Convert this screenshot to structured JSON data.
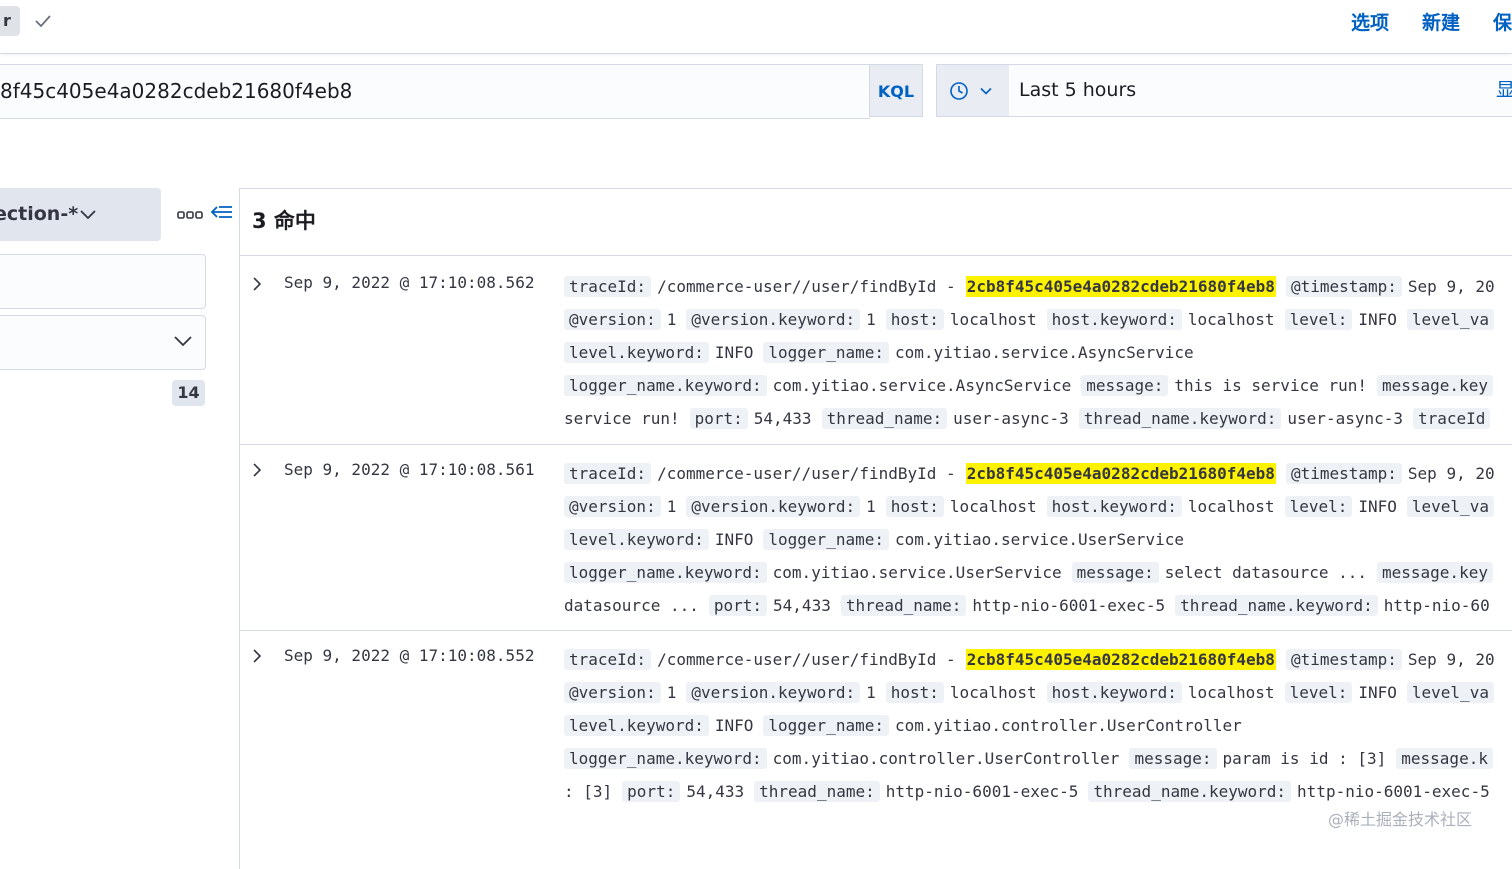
{
  "topbar": {
    "pill_label": "r",
    "options_label": "选项",
    "new_label": "新建",
    "save_label": "保"
  },
  "query": {
    "value": "8f45c405e4a0282cdeb21680f4eb8",
    "kql_label": "KQL"
  },
  "time": {
    "range": "Last 5 hours",
    "show_label": "显"
  },
  "sidebar": {
    "index_pattern": "ection-*",
    "field_count": "14"
  },
  "results": {
    "hits_label": "3 命中",
    "rows": [
      {
        "timestamp": "Sep 9, 2022 @ 17:10:08.562",
        "l1": {
          "k1": "traceId:",
          "v1": "/commerce-user//user/findById -",
          "hl": "2cb8f45c405e4a0282cdeb21680f4eb8",
          "k2": "@timestamp:",
          "v2": "Sep 9, 20"
        },
        "l2": {
          "k1": "@version:",
          "v1": "1",
          "k2": "@version.keyword:",
          "v2": "1",
          "k3": "host:",
          "v3": "localhost",
          "k4": "host.keyword:",
          "v4": "localhost",
          "k5": "level:",
          "v5": "INFO",
          "k6": "level_va"
        },
        "l3": {
          "k1": "level.keyword:",
          "v1": "INFO",
          "k2": "logger_name:",
          "v2": "com.yitiao.service.AsyncService"
        },
        "l4": {
          "k1": "logger_name.keyword:",
          "v1": "com.yitiao.service.AsyncService",
          "k2": "message:",
          "v2": "this is service run!",
          "k3": "message.key"
        },
        "l5": {
          "v0": "service run!",
          "k1": "port:",
          "v1": "54,433",
          "k2": "thread_name:",
          "v2": "user-async-3",
          "k3": "thread_name.keyword:",
          "v3": "user-async-3",
          "k4": "traceId"
        }
      },
      {
        "timestamp": "Sep 9, 2022 @ 17:10:08.561",
        "l1": {
          "k1": "traceId:",
          "v1": "/commerce-user//user/findById -",
          "hl": "2cb8f45c405e4a0282cdeb21680f4eb8",
          "k2": "@timestamp:",
          "v2": "Sep 9, 20"
        },
        "l2": {
          "k1": "@version:",
          "v1": "1",
          "k2": "@version.keyword:",
          "v2": "1",
          "k3": "host:",
          "v3": "localhost",
          "k4": "host.keyword:",
          "v4": "localhost",
          "k5": "level:",
          "v5": "INFO",
          "k6": "level_va"
        },
        "l3": {
          "k1": "level.keyword:",
          "v1": "INFO",
          "k2": "logger_name:",
          "v2": "com.yitiao.service.UserService"
        },
        "l4": {
          "k1": "logger_name.keyword:",
          "v1": "com.yitiao.service.UserService",
          "k2": "message:",
          "v2": "select datasource ...",
          "k3": "message.key"
        },
        "l5": {
          "v0": "datasource ...",
          "k1": "port:",
          "v1": "54,433",
          "k2": "thread_name:",
          "v2": "http-nio-6001-exec-5",
          "k3": "thread_name.keyword:",
          "v3": "http-nio-60",
          "k4": ""
        }
      },
      {
        "timestamp": "Sep 9, 2022 @ 17:10:08.552",
        "l1": {
          "k1": "traceId:",
          "v1": "/commerce-user//user/findById -",
          "hl": "2cb8f45c405e4a0282cdeb21680f4eb8",
          "k2": "@timestamp:",
          "v2": "Sep 9, 20"
        },
        "l2": {
          "k1": "@version:",
          "v1": "1",
          "k2": "@version.keyword:",
          "v2": "1",
          "k3": "host:",
          "v3": "localhost",
          "k4": "host.keyword:",
          "v4": "localhost",
          "k5": "level:",
          "v5": "INFO",
          "k6": "level_va"
        },
        "l3": {
          "k1": "level.keyword:",
          "v1": "INFO",
          "k2": "logger_name:",
          "v2": "com.yitiao.controller.UserController"
        },
        "l4": {
          "k1": "logger_name.keyword:",
          "v1": "com.yitiao.controller.UserController",
          "k2": "message:",
          "v2": "param is id : [3]",
          "k3": "message.k"
        },
        "l5": {
          "v0": ": [3]",
          "k1": "port:",
          "v1": "54,433",
          "k2": "thread_name:",
          "v2": "http-nio-6001-exec-5",
          "k3": "thread_name.keyword:",
          "v3": "http-nio-6001-exec-5",
          "k4": ""
        }
      }
    ]
  },
  "watermark": "@稀土掘金技术社区"
}
